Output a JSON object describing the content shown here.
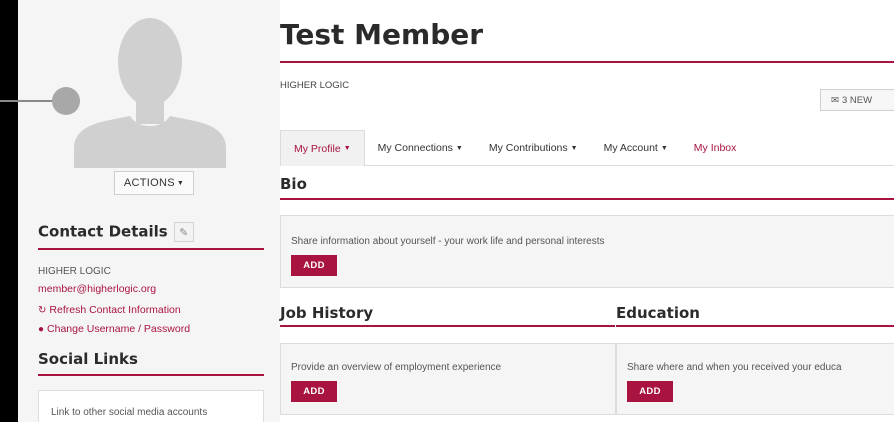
{
  "profile": {
    "actions_label": "ACTIONS",
    "name": "Test Member",
    "organization": "HIGHER LOGIC",
    "new_messages_label": "3 NEW"
  },
  "contact": {
    "heading": "Contact Details",
    "organization": "HIGHER LOGIC",
    "email": "member@higherlogic.org",
    "refresh_label": "Refresh Contact Information",
    "change_credentials_label": "Change Username / Password"
  },
  "social": {
    "heading": "Social Links",
    "placeholder_text": "Link to other social media accounts"
  },
  "tabs": [
    {
      "label": "My Profile"
    },
    {
      "label": "My Connections"
    },
    {
      "label": "My Contributions"
    },
    {
      "label": "My Account"
    },
    {
      "label": "My Inbox"
    }
  ],
  "bio": {
    "heading": "Bio",
    "prompt": "Share information about yourself - your work life and personal interests",
    "add_label": "ADD"
  },
  "job_history": {
    "heading": "Job History",
    "prompt": "Provide an overview of employment experience",
    "add_label": "ADD"
  },
  "education": {
    "heading": "Education",
    "prompt": "Share where and when you received your educa",
    "add_label": "ADD"
  },
  "colors": {
    "accent": "#a8143f",
    "panel": "#f5f5f5"
  }
}
